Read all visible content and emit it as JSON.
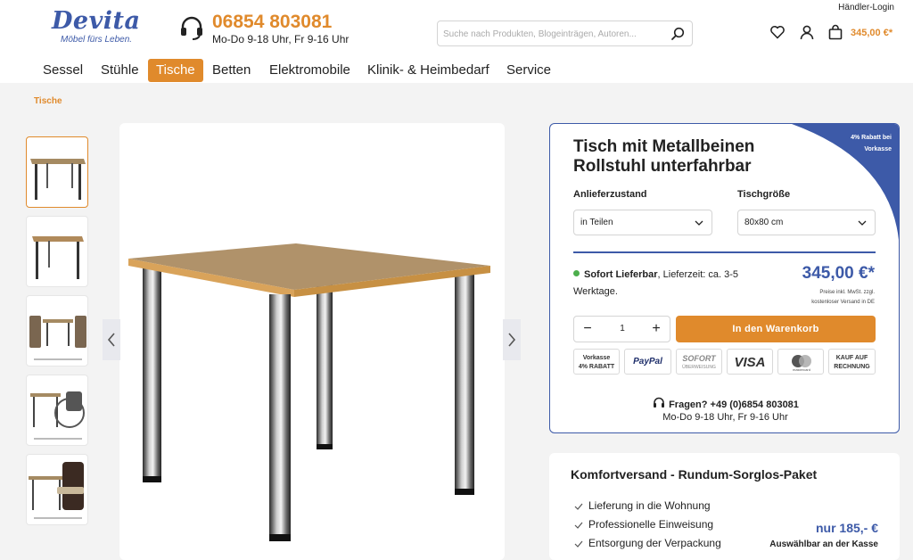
{
  "header": {
    "logo_name": "Devita",
    "logo_tagline": "Möbel fürs Leben.",
    "phone_number": "06854 803081",
    "phone_hours": "Mo-Do 9-18 Uhr, Fr 9-16 Uhr",
    "search_placeholder": "Suche nach Produkten, Blogeinträgen, Autoren...",
    "dealer_login": "Händler-Login",
    "cart_total": "345,00 €*",
    "icons": [
      "headset-icon",
      "search-icon",
      "heart-icon",
      "user-icon",
      "cart-icon"
    ]
  },
  "nav": {
    "items": [
      "Sessel",
      "Stühle",
      "Tische",
      "Betten",
      "Elektromobile",
      "Klinik- & Heimbedarf",
      "Service"
    ],
    "active": "Tische"
  },
  "breadcrumb": "Tische",
  "product": {
    "title_line1": "Tisch mit Metallbeinen",
    "title_line2": "Rollstuhl unterfahrbar",
    "promo_line1": "4% Rabatt bei",
    "promo_line2": "Vorkasse",
    "option1_label": "Anlieferzustand",
    "option1_value": "in Teilen",
    "option2_label": "Tischgröße",
    "option2_value": "80x80 cm",
    "availability_bold": "Sofort Lieferbar",
    "availability_text": ", Lieferzeit: ca. 3-5 Werktage.",
    "price": "345,00 €*",
    "price_note_line1": "Preise inkl. MwSt. zzgl.",
    "price_note_line2": "kostenloser Versand in DE",
    "quantity": "1",
    "qty_minus": "−",
    "qty_plus": "+",
    "add_to_cart": "In den Warenkorb",
    "payments": {
      "vorkasse_line1": "Vorkasse",
      "vorkasse_line2": "4% RABATT",
      "paypal": "PayPal",
      "sofort_line1": "SOFORT",
      "sofort_line2": "ÜBERWEISUNG",
      "visa": "VISA",
      "mastercard": "mastercard",
      "invoice_line1": "KAUF AUF",
      "invoice_line2": "RECHNUNG"
    },
    "help_question": "Fragen? +49 (0)6854 803081",
    "help_hours": "Mo-Do 9-18 Uhr, Fr 9-16 Uhr"
  },
  "comfort": {
    "title": "Komfortversand - Rundum-Sorglos-Paket",
    "items": [
      "Lieferung in die Wohnung",
      "Professionelle Einweisung",
      "Entsorgung der Verpackung"
    ],
    "price": "nur 185,- €",
    "note": "Auswählbar an der Kasse"
  },
  "colors": {
    "brand_blue": "#3d5aa8",
    "accent_orange": "#e08a2c",
    "available_green": "#4cae4c"
  }
}
